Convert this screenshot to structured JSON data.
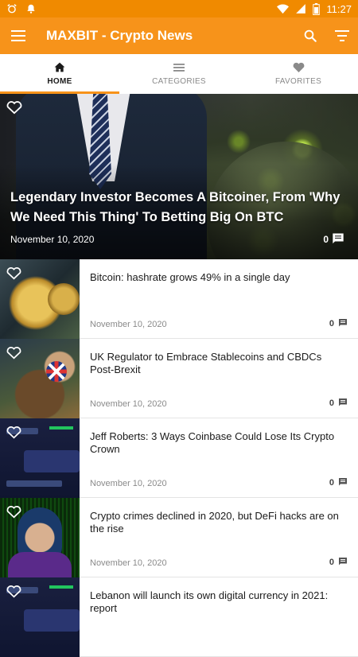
{
  "status_bar": {
    "time": "11:27"
  },
  "app_bar": {
    "title": "MAXBIT - Crypto News",
    "menu_icon": "hamburger-icon",
    "search_icon": "search-icon",
    "filter_icon": "filter-icon"
  },
  "tabs": [
    {
      "label": "HOME",
      "icon": "home-icon",
      "active": true
    },
    {
      "label": "CATEGORIES",
      "icon": "list-icon",
      "active": false
    },
    {
      "label": "FAVORITES",
      "icon": "heart-icon",
      "active": false
    }
  ],
  "featured": {
    "title": "Legendary Investor Becomes A Bitcoiner, From 'Why We Need This Thing' To Betting Big On BTC",
    "date": "November 10, 2020",
    "comments": "0"
  },
  "articles": [
    {
      "title": "Bitcoin: hashrate grows 49% in a single day",
      "date": "November 10, 2020",
      "comments": "0"
    },
    {
      "title": "UK Regulator to Embrace Stablecoins and CBDCs Post-Brexit",
      "date": "November 10, 2020",
      "comments": "0"
    },
    {
      "title": "Jeff Roberts: 3 Ways Coinbase Could Lose Its Crypto Crown",
      "date": "November 10, 2020",
      "comments": "0"
    },
    {
      "title": "Crypto crimes declined in 2020, but DeFi hacks are on the rise",
      "date": "November 10, 2020",
      "comments": "0"
    },
    {
      "title": "Lebanon will launch its own digital currency in 2021: report",
      "date": "",
      "comments": ""
    }
  ],
  "colors": {
    "accent": "#f7931a",
    "status_bar": "#f08a00"
  }
}
